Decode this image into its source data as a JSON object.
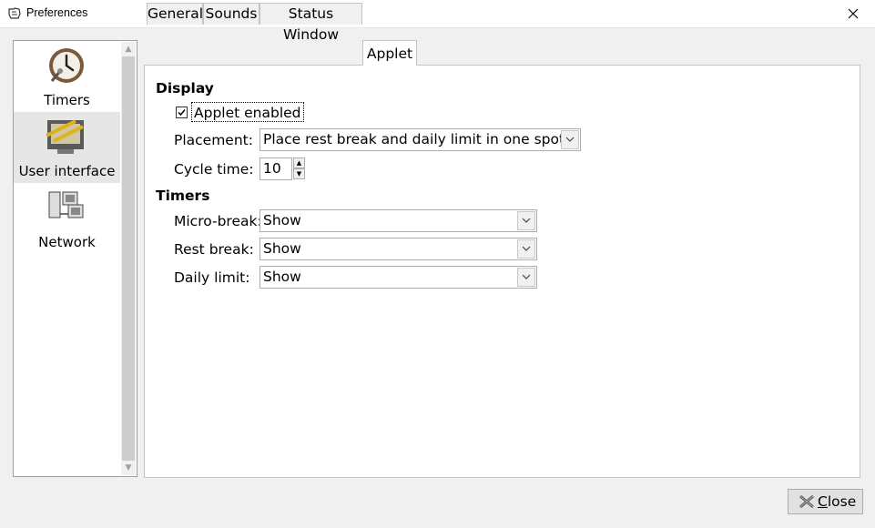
{
  "window": {
    "title": "Preferences"
  },
  "sidebar": {
    "items": [
      {
        "label": "Timers",
        "icon": "timer-clock-icon",
        "selected": false
      },
      {
        "label": "User interface",
        "icon": "user-interface-icon",
        "selected": true
      },
      {
        "label": "Network",
        "icon": "network-computers-icon",
        "selected": false
      }
    ]
  },
  "tabs": [
    {
      "label": "General",
      "active": false
    },
    {
      "label": "Sounds",
      "active": false
    },
    {
      "label": "Status Window",
      "active": false
    },
    {
      "label": "Applet",
      "active": true
    }
  ],
  "display": {
    "heading": "Display",
    "applet_enabled": {
      "label": "Applet enabled",
      "checked": true
    },
    "placement": {
      "label": "Placement:",
      "value": "Place rest break and daily limit in one spot"
    },
    "cycle_time": {
      "label": "Cycle time:",
      "value": "10"
    }
  },
  "timers": {
    "heading": "Timers",
    "micro_break": {
      "label": "Micro-break:",
      "value": "Show"
    },
    "rest_break": {
      "label": "Rest break:",
      "value": "Show"
    },
    "daily_limit": {
      "label": "Daily limit:",
      "value": "Show"
    }
  },
  "footer": {
    "close_label": "Close"
  }
}
